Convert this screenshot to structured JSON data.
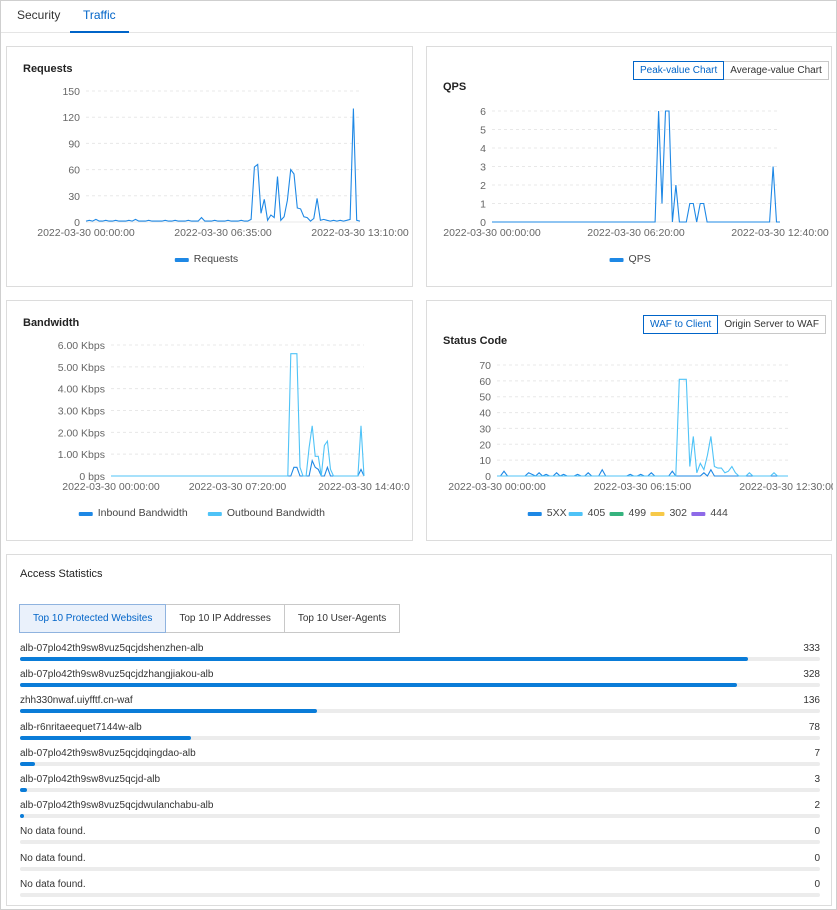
{
  "tabs": [
    {
      "label": "Security"
    },
    {
      "label": "Traffic"
    }
  ],
  "requests_card": {
    "title": "Requests",
    "chart_data": {
      "type": "line",
      "yticks": [
        "150",
        "120",
        "90",
        "60",
        "30",
        "0"
      ],
      "ylim": [
        0,
        150
      ],
      "xticks": [
        "2022-03-30 00:00:00",
        "2022-03-30 06:35:00",
        "2022-03-30 13:10:00"
      ],
      "series": [
        {
          "name": "Requests",
          "color": "#1e88e5",
          "values": [
            1,
            2,
            1,
            3,
            1,
            1,
            2,
            1,
            1,
            2,
            1,
            1,
            1,
            2,
            1,
            3,
            1,
            1,
            1,
            2,
            1,
            1,
            1,
            1,
            2,
            1,
            1,
            2,
            1,
            1,
            1,
            2,
            1,
            1,
            1,
            5,
            1,
            1,
            1,
            2,
            1,
            1,
            1,
            2,
            1,
            1,
            1,
            2,
            1,
            1,
            3,
            63,
            66,
            10,
            26,
            2,
            8,
            5,
            52,
            2,
            6,
            25,
            60,
            55,
            16,
            15,
            6,
            5,
            1,
            4,
            27,
            2,
            3,
            2,
            1,
            2,
            1,
            2,
            1,
            2,
            3,
            130,
            2,
            1
          ]
        }
      ]
    }
  },
  "qps_card": {
    "title": "QPS",
    "buttons": [
      "Peak-value Chart",
      "Average-value Chart"
    ],
    "chart_data": {
      "type": "line",
      "yticks": [
        "6",
        "5",
        "4",
        "3",
        "2",
        "1",
        "0"
      ],
      "ylim": [
        0,
        6
      ],
      "xticks": [
        "2022-03-30 00:00:00",
        "2022-03-30 06:20:00",
        "2022-03-30 12:40:00"
      ],
      "series": [
        {
          "name": "QPS",
          "color": "#1e88e5",
          "values": [
            0,
            0,
            0,
            0,
            0,
            0,
            0,
            0,
            0,
            0,
            0,
            0,
            0,
            0,
            0,
            0,
            0,
            0,
            0,
            0,
            0,
            0,
            0,
            0,
            0,
            0,
            0,
            0,
            0,
            0,
            0,
            0,
            0,
            0,
            0,
            0,
            0,
            0,
            0,
            0,
            0,
            0,
            0,
            0,
            0,
            0,
            0,
            0,
            6,
            1,
            6,
            6,
            0,
            2,
            0,
            0,
            0,
            1,
            1,
            0,
            1,
            1,
            0,
            0,
            0,
            0,
            0,
            0,
            0,
            0,
            0,
            0,
            0,
            0,
            0,
            0,
            0,
            0,
            0,
            0,
            0,
            3,
            0,
            0
          ]
        }
      ]
    }
  },
  "bandwidth_card": {
    "title": "Bandwidth",
    "chart_data": {
      "type": "line",
      "yticks": [
        "6.00 Kbps",
        "5.00 Kbps",
        "4.00 Kbps",
        "3.00 Kbps",
        "2.00 Kbps",
        "1.00 Kbps",
        "0 bps"
      ],
      "ylim": [
        0,
        6
      ],
      "xticks": [
        "2022-03-30 00:00:00",
        "2022-03-30 07:20:00",
        "2022-03-30 14:40:0"
      ],
      "series": [
        {
          "name": "Inbound Bandwidth",
          "color": "#1e88e5",
          "values": [
            0,
            0,
            0,
            0,
            0,
            0,
            0,
            0,
            0,
            0,
            0,
            0,
            0,
            0,
            0,
            0,
            0,
            0,
            0,
            0,
            0,
            0,
            0,
            0,
            0,
            0,
            0,
            0,
            0,
            0,
            0,
            0,
            0,
            0,
            0,
            0,
            0,
            0,
            0,
            0,
            0,
            0,
            0,
            0,
            0,
            0,
            0,
            0,
            0,
            0,
            0,
            0,
            0,
            0,
            0,
            0,
            0,
            0,
            0,
            0,
            0.4,
            0.4,
            0,
            0,
            0,
            0,
            0.7,
            0.4,
            0.3,
            0,
            0,
            0.4,
            0,
            0,
            0,
            0,
            0,
            0,
            0,
            0,
            0,
            0,
            0.3,
            0
          ]
        },
        {
          "name": "Outbound Bandwidth",
          "color": "#4fc3f7",
          "values": [
            0,
            0,
            0,
            0,
            0,
            0,
            0,
            0,
            0,
            0,
            0,
            0,
            0,
            0,
            0,
            0,
            0,
            0,
            0,
            0,
            0,
            0,
            0,
            0,
            0,
            0,
            0,
            0,
            0,
            0,
            0,
            0,
            0,
            0,
            0,
            0,
            0,
            0,
            0,
            0,
            0,
            0,
            0,
            0,
            0,
            0,
            0,
            0,
            0,
            0,
            0,
            0,
            0,
            0,
            0,
            0,
            0,
            0,
            0,
            5.6,
            5.6,
            5.6,
            0.4,
            0,
            0,
            1.3,
            2.3,
            0.9,
            0.9,
            0,
            1.4,
            1.6,
            0.3,
            0,
            0,
            0,
            0,
            0,
            0,
            0,
            0,
            0,
            2.3,
            0
          ]
        }
      ]
    }
  },
  "status_card": {
    "title": "Status Code",
    "buttons": [
      "WAF to Client",
      "Origin Server to WAF"
    ],
    "chart_data": {
      "type": "line",
      "yticks": [
        "70",
        "60",
        "50",
        "40",
        "30",
        "20",
        "10",
        "0"
      ],
      "ylim": [
        0,
        70
      ],
      "xticks": [
        "2022-03-30 00:00:00",
        "2022-03-30 06:15:00",
        "2022-03-30 12:30:00"
      ],
      "series": [
        {
          "name": "5XX",
          "color": "#1e88e5",
          "values": [
            0,
            0,
            3,
            0,
            0,
            0,
            0,
            0,
            0,
            2,
            1,
            0,
            2,
            0,
            1,
            0,
            0,
            2,
            0,
            1,
            0,
            0,
            0,
            1,
            0,
            0,
            2,
            0,
            0,
            0,
            4,
            0,
            0,
            0,
            0,
            0,
            0,
            0,
            1,
            0,
            0,
            1,
            0,
            0,
            2,
            0,
            0,
            0,
            0,
            0,
            3,
            0,
            0,
            0,
            0,
            0,
            0,
            0,
            0,
            2,
            0,
            4,
            0,
            0,
            0,
            0,
            0,
            0,
            0,
            0,
            0,
            0,
            0,
            0,
            0,
            0,
            0,
            0,
            0,
            0,
            0,
            0,
            0,
            0
          ]
        },
        {
          "name": "405",
          "color": "#4fc3f7",
          "values": [
            0,
            0,
            0,
            0,
            0,
            0,
            0,
            0,
            0,
            0,
            0,
            0,
            0,
            0,
            0,
            0,
            0,
            0,
            0,
            0,
            0,
            0,
            0,
            0,
            0,
            0,
            0,
            0,
            0,
            0,
            0,
            0,
            0,
            0,
            0,
            0,
            0,
            0,
            0,
            0,
            0,
            0,
            0,
            0,
            0,
            0,
            0,
            0,
            0,
            0,
            0,
            0,
            61,
            61,
            61,
            6,
            25,
            2,
            8,
            4,
            13,
            25,
            6,
            5,
            5,
            2,
            3,
            6,
            2,
            0,
            0,
            0,
            2,
            0,
            0,
            0,
            0,
            0,
            0,
            2,
            0,
            0,
            0,
            0
          ]
        },
        {
          "name": "499",
          "color": "#36b37e",
          "values": [
            0
          ]
        },
        {
          "name": "302",
          "color": "#f7c948",
          "values": [
            0
          ]
        },
        {
          "name": "444",
          "color": "#8e6ae8",
          "values": [
            0
          ]
        }
      ]
    }
  },
  "access": {
    "title": "Access Statistics",
    "tabs": [
      "Top 10 Protected Websites",
      "Top 10 IP Addresses",
      "Top 10 User-Agents"
    ],
    "max": 333,
    "rows": [
      {
        "label": "alb-07plo42th9sw8vuz5qcjdshenzhen-alb",
        "count": "333",
        "value": 333
      },
      {
        "label": "alb-07plo42th9sw8vuz5qcjdzhangjiakou-alb",
        "count": "328",
        "value": 328
      },
      {
        "label": "zhh330nwaf.uiyfftf.cn-waf",
        "count": "136",
        "value": 136
      },
      {
        "label": "alb-r6nritaeequet7144w-alb",
        "count": "78",
        "value": 78
      },
      {
        "label": "alb-07plo42th9sw8vuz5qcjdqingdao-alb",
        "count": "7",
        "value": 7
      },
      {
        "label": "alb-07plo42th9sw8vuz5qcjd-alb",
        "count": "3",
        "value": 3
      },
      {
        "label": "alb-07plo42th9sw8vuz5qcjdwulanchabu-alb",
        "count": "2",
        "value": 2
      },
      {
        "label": "No data found.",
        "count": "0",
        "value": 0
      },
      {
        "label": "No data found.",
        "count": "0",
        "value": 0
      },
      {
        "label": "No data found.",
        "count": "0",
        "value": 0
      }
    ]
  }
}
